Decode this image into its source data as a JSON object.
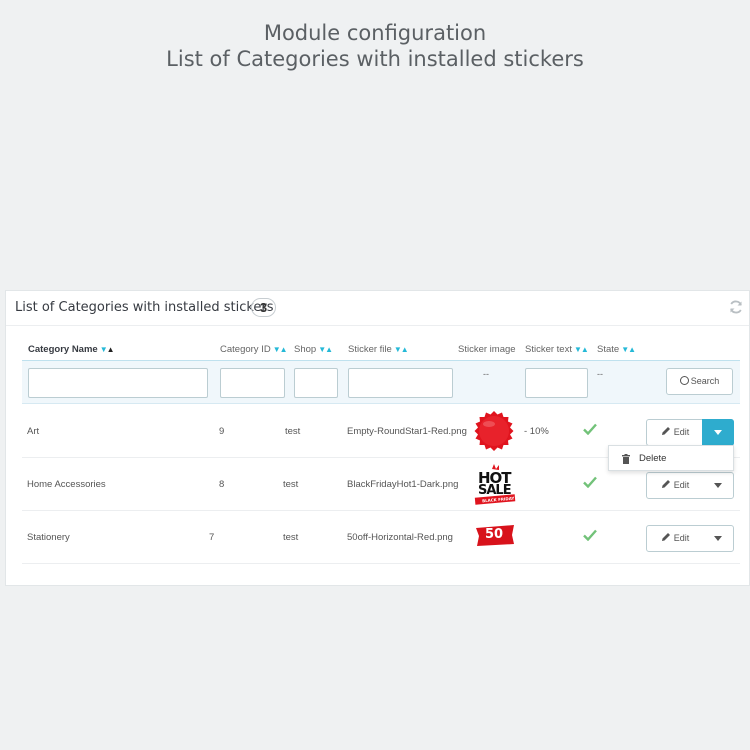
{
  "heading": {
    "line1": "Module configuration",
    "line2": "List of Categories with installed stickers"
  },
  "panel": {
    "title": "List of Categories with installed stickers",
    "count": "3",
    "refresh_icon": "refresh-icon"
  },
  "columns": {
    "category_name": "Category Name",
    "category_id": "Category ID",
    "shop": "Shop",
    "sticker_file": "Sticker file",
    "sticker_image": "Sticker image",
    "sticker_text": "Sticker text",
    "state": "State"
  },
  "filters": {
    "sticker_image_placeholder": "--",
    "state_placeholder": "--",
    "search_label": "Search"
  },
  "rows": [
    {
      "name": "Art",
      "id": "9",
      "shop": "test",
      "file": "Empty-RoundStar1-Red.png",
      "image": "red-round-star",
      "text": "- 10%",
      "state": "enabled"
    },
    {
      "name": "Home Accessories",
      "id": "8",
      "shop": "test",
      "file": "BlackFridayHot1-Dark.png",
      "image": "hot-sale-black-friday",
      "text": "",
      "state": "enabled"
    },
    {
      "name": "Stationery",
      "id": "7",
      "shop": "test",
      "file": "50off-Horizontal-Red.png",
      "image": "50-off-red-ribbon",
      "text": "",
      "state": "enabled"
    }
  ],
  "actions": {
    "edit_label": "Edit",
    "delete_label": "Delete"
  },
  "sticker_labels": {
    "hot": "HOT",
    "sale": "SALE",
    "black_friday": "BLACK FRIDAY",
    "fifty": "50"
  },
  "colors": {
    "accent": "#2eacce",
    "check": "#72c279",
    "sticker_red": "#e0141e"
  }
}
